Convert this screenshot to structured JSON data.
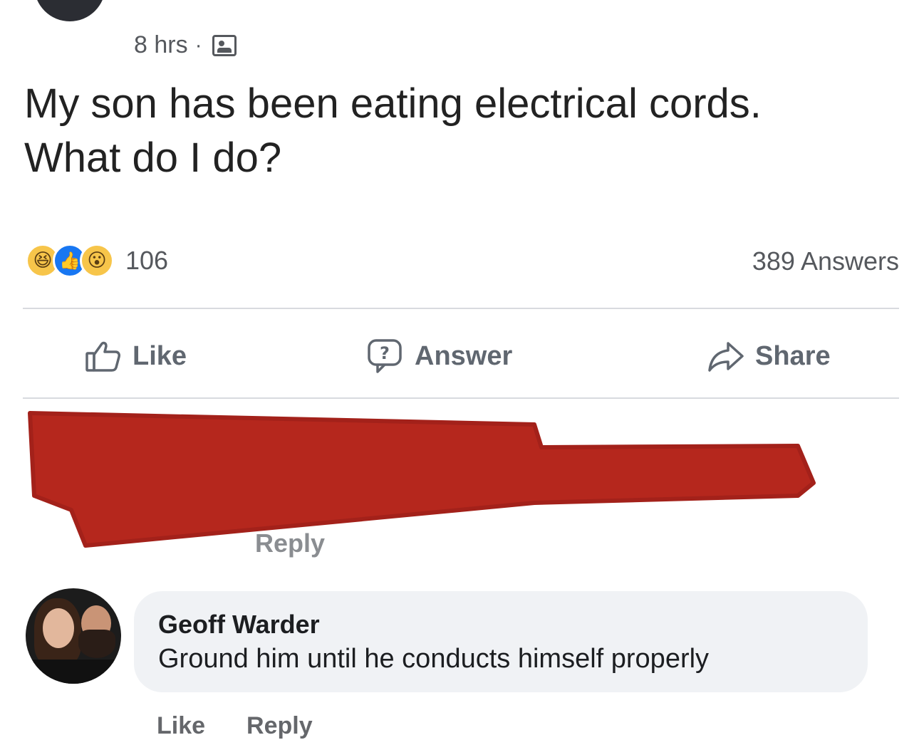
{
  "post": {
    "time": "8 hrs",
    "separator": "·",
    "audience_icon": "group-icon",
    "text": "My son has been eating electrical cords. What do I do?"
  },
  "stats": {
    "reactions": [
      "haha",
      "like",
      "wow"
    ],
    "reaction_count": "106",
    "answers_count": "389 Answers"
  },
  "actions": {
    "like_label": "Like",
    "answer_label": "Answer",
    "share_label": "Share"
  },
  "redacted_comment": {
    "reply_label": "Reply",
    "redaction_color": "#b5271d"
  },
  "comment": {
    "author": "Geoff Warder",
    "text": "Ground him until he conducts himself properly",
    "like_label": "Like",
    "reply_label": "Reply"
  },
  "colors": {
    "action_gray": "#606770",
    "bubble_bg": "#f0f2f5",
    "like_blue": "#1877f2"
  }
}
